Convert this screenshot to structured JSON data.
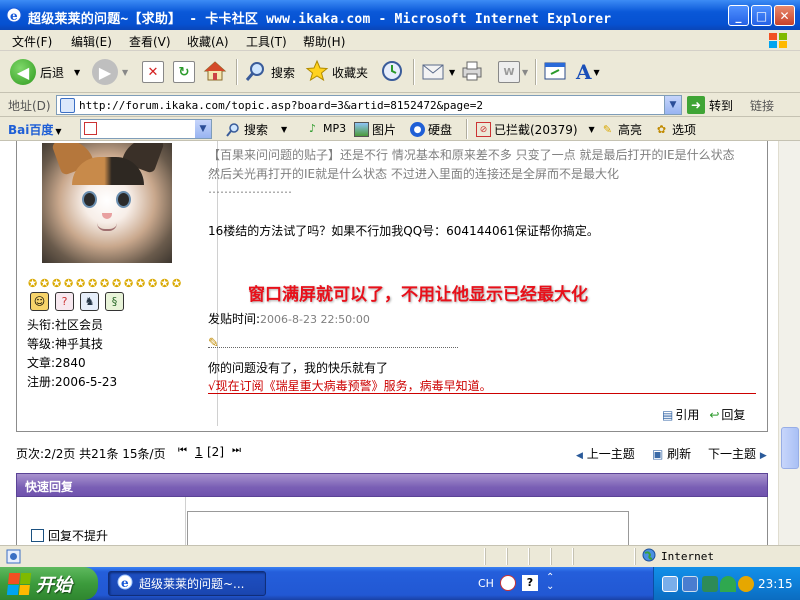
{
  "window": {
    "title": "超级莱莱的问题~【求助】 - 卡卡社区 www.ikaka.com - Microsoft Internet Explorer",
    "buttons": {
      "minimize": "_",
      "maximize": "□",
      "close": "✕"
    }
  },
  "menubar": {
    "items": [
      "文件(F)",
      "编辑(E)",
      "查看(V)",
      "收藏(A)",
      "工具(T)",
      "帮助(H)"
    ]
  },
  "toolbar": {
    "back_label": "后退",
    "search_label": "搜索",
    "favorites_label": "收藏夹"
  },
  "address": {
    "label": "地址(D)",
    "url": "http://forum.ikaka.com/topic.asp?board=3&artid=8152472&page=2",
    "go_label": "转到",
    "links_label": "链接"
  },
  "baidu": {
    "logo": "Bai百度",
    "search_label": "搜索",
    "mp3_label": "MP3",
    "image_label": "图片",
    "drive_label": "硬盘",
    "blocked_label": "已拦截(20379)",
    "highlight_label": "高亮",
    "options_label": "选项"
  },
  "post": {
    "user": {
      "title": "头衔:社区会员",
      "level": "等级:神乎其技",
      "posts": "文章:2840",
      "registered": "注册:2006-5-23",
      "stars": 13
    },
    "quoted_line1": "【百果来问问题的贴子】还是不行 情况基本和原来差不多 只变了一点 就是最后打开的IE是什么状态",
    "quoted_line2": "然后关光再打开的IE就是什么状态 不过进入里面的连接还是全屏而不是最大化",
    "quoted_dots": "…………………",
    "reply_text": "16楼结的方法试了吗？如果不行加我QQ号：604144061保证帮你搞定。",
    "highlight": "窗口满屏就可以了，不用让他显示已经最大化",
    "posted_time_label": "发贴时间:",
    "posted_time": "2006-8-23 22:50:00",
    "signature": "你的问题没有了，我的快乐就有了",
    "ad_link": "√现在订阅《瑞星重大病毒预警》服务，病毒早知道。",
    "quote_label": "引用",
    "reply_label": "回复"
  },
  "pager": {
    "info": "页次:2/2页  共21条  15条/页",
    "first": "⏮",
    "page1": "1",
    "current": "[2]",
    "last": "⏭",
    "prev_topic": "上一主题",
    "refresh": "刷新",
    "next_topic": "下一主题"
  },
  "quick_reply": {
    "header": "快速回复",
    "no_bump_label": "回复不提升"
  },
  "status": {
    "zone": "Internet"
  },
  "taskbar": {
    "start_label": "开始",
    "task_label": "超级莱莱的问题~...",
    "ime": "CH",
    "clock": "23:15"
  }
}
